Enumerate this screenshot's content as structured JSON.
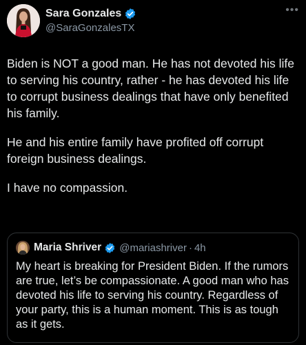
{
  "tweet": {
    "author_name": "Sara Gonzales",
    "author_handle": "@SaraGonzalesTX",
    "more_label": "•••",
    "paragraphs": [
      "Biden is NOT a good man. He has not devoted his life to serving his country, rather - he has devoted his life to corrupt business dealings that have only benefited his family.",
      "He and his entire family have profited off corrupt foreign business dealings.",
      "I have no compassion."
    ]
  },
  "quoted_tweet": {
    "author_name": "Maria Shriver",
    "author_handle": "@mariashriver",
    "separator": "·",
    "time": "4h",
    "text": "My heart is breaking for President Biden. If the rumors are true, let’s be compassionate. A good man who has devoted his life to serving his country. Regardless of your party, this is a human moment. This is as tough as it gets."
  },
  "icons": {
    "verified": "verified-badge-icon",
    "more": "more-options-icon"
  },
  "colors": {
    "background": "#000000",
    "text_primary": "#e7e9ea",
    "text_secondary": "#8b98a5",
    "verified_blue": "#1d9bf0",
    "border": "#2f3336"
  }
}
